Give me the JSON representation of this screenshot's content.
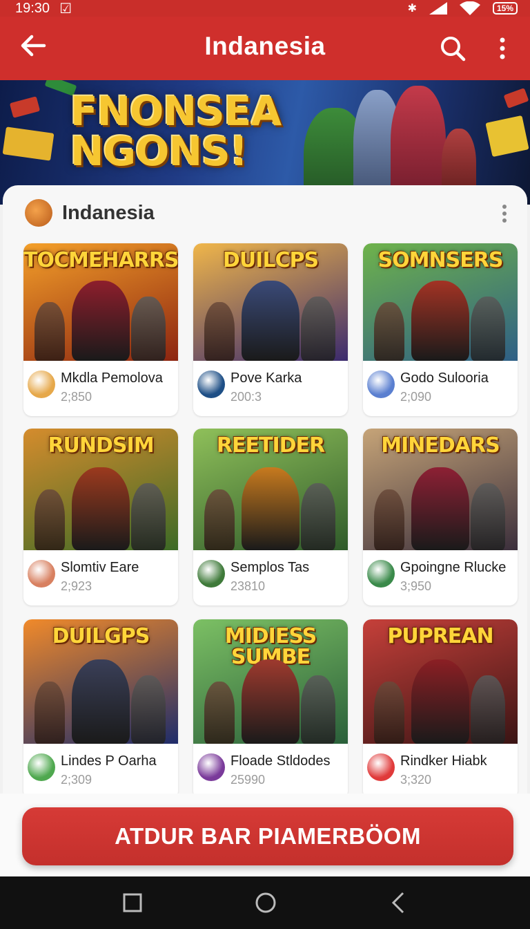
{
  "status_bar": {
    "time": "19:30",
    "battery": "15%"
  },
  "app_bar": {
    "title": "Indanesia"
  },
  "banner": {
    "headline_line1": "FNONSEA",
    "headline_line2": "NGONS!"
  },
  "panel": {
    "title": "Indanesia"
  },
  "games": [
    {
      "thumb_title": "TOCMEHARRS",
      "name": "Mkdla Pemolova",
      "count": "2;850",
      "bg1": "#f4a02a",
      "bg2": "#8c2410",
      "fig": "#8e1e2c"
    },
    {
      "thumb_title": "DUILCPS",
      "name": "Pove Karka",
      "count": "200:3",
      "bg1": "#f0b64a",
      "bg2": "#3b2a6e",
      "fig": "#3a4a78"
    },
    {
      "thumb_title": "SOMNSERS",
      "name": "Godo Sulooria",
      "count": "2;090",
      "bg1": "#6fb34b",
      "bg2": "#2e5f86",
      "fig": "#a33324"
    },
    {
      "thumb_title": "RUNDSIM",
      "name": "Slomtiv Eare",
      "count": "2;923",
      "bg1": "#d58c2d",
      "bg2": "#3c6a26",
      "fig": "#9c3a1e"
    },
    {
      "thumb_title": "REETIDER",
      "name": "Semplos Tas",
      "count": "23810",
      "bg1": "#8fc05a",
      "bg2": "#2f5a2a",
      "fig": "#c77a1e"
    },
    {
      "thumb_title": "MINEDARS",
      "name": "Gpoingne Rlucke",
      "count": "3;950",
      "bg1": "#c6a478",
      "bg2": "#3b2f3c",
      "fig": "#8d2034"
    },
    {
      "thumb_title": "DUILGPS",
      "name": "Lindes P Oarha",
      "count": "2;309",
      "bg1": "#f18a2a",
      "bg2": "#1e2c6a",
      "fig": "#3a3f58"
    },
    {
      "thumb_title": "MIDIESS SUMBE",
      "name": "Floade Stldodes",
      "count": "25990",
      "bg1": "#7cc064",
      "bg2": "#2a5f3a",
      "fig": "#9e3a2e"
    },
    {
      "thumb_title": "PUPREAN",
      "name": "Rindker Hiabk",
      "count": "3;320",
      "bg1": "#c6403a",
      "bg2": "#3a1414",
      "fig": "#8b1f24"
    }
  ],
  "cta": {
    "label": "ATDUR BAR PIAMERBÖOM"
  }
}
